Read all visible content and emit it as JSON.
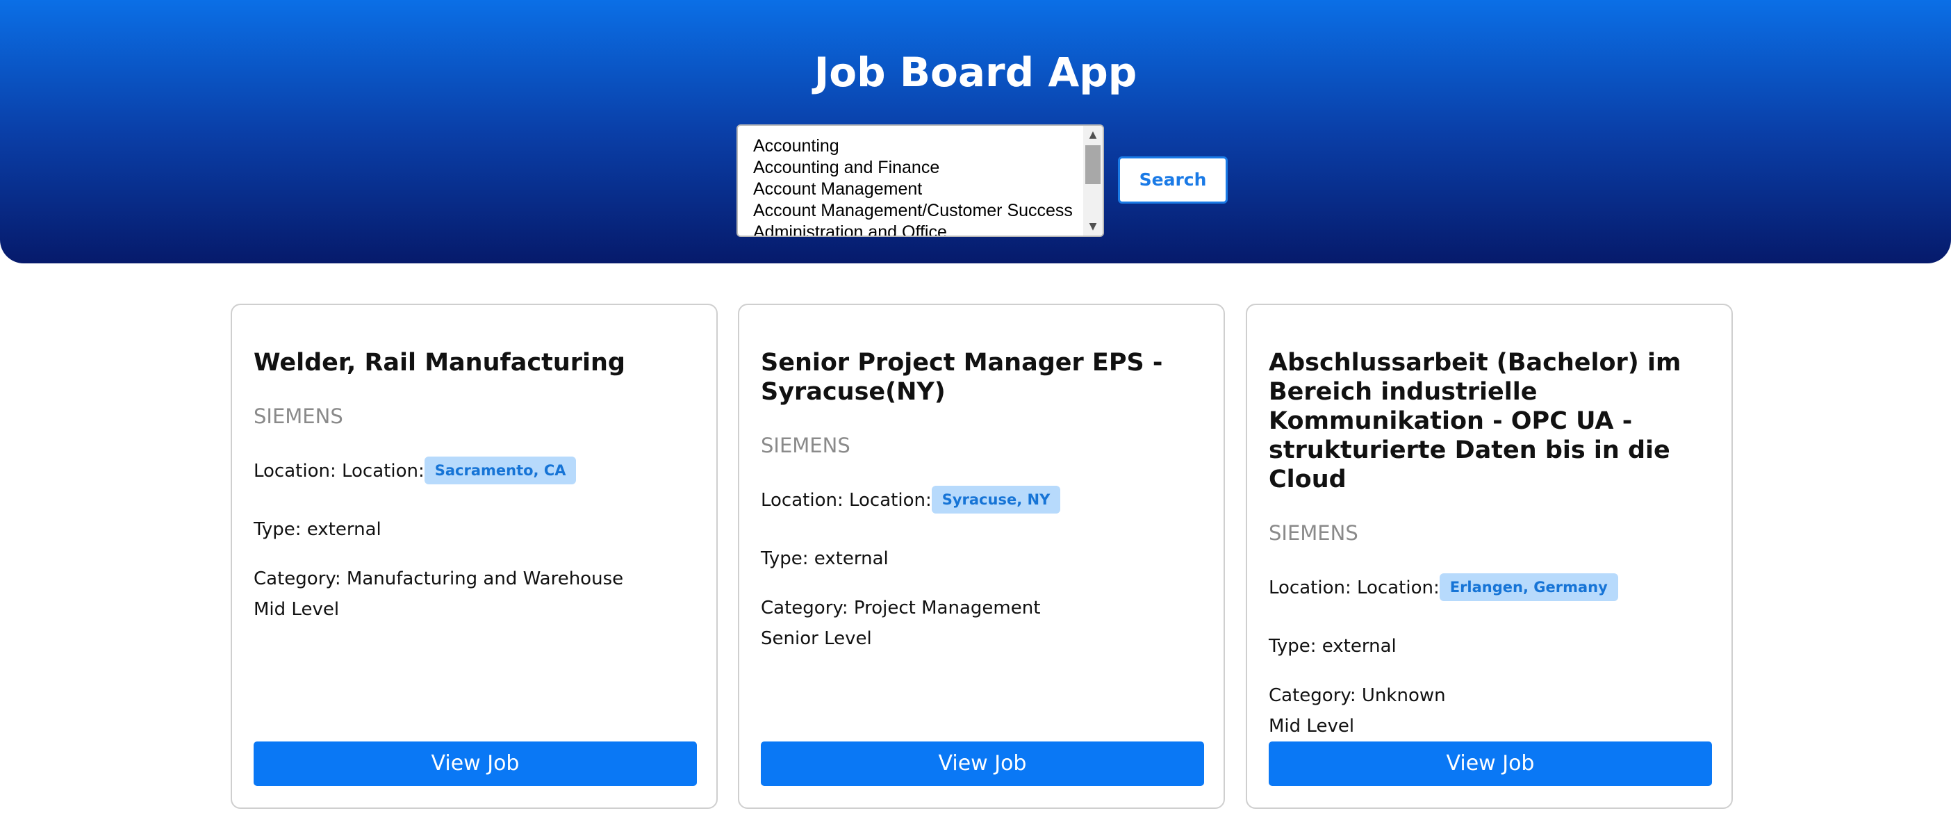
{
  "header": {
    "title": "Job Board App",
    "search_button_label": "Search"
  },
  "category_select": {
    "options": [
      "Accounting",
      "Accounting and Finance",
      "Account Management",
      "Account Management/Customer Success",
      "Administration and Office"
    ]
  },
  "colors": {
    "header_gradient_top": "#0b6fe6",
    "header_gradient_bottom": "#061a6b",
    "accent": "#0a78f5",
    "badge_bg": "#b7dafc",
    "badge_text": "#1674d6"
  },
  "jobs": [
    {
      "title": "Welder, Rail Manufacturing",
      "company": "SIEMENS",
      "location_label": "Location: Location:",
      "location": "Sacramento, CA",
      "type": "Type: external",
      "category": "Category: Manufacturing and Warehouse",
      "level": "Mid Level",
      "button_label": "View Job"
    },
    {
      "title": "Senior Project Manager EPS - Syracuse(NY)",
      "company": "SIEMENS",
      "location_label": "Location: Location:",
      "location": "Syracuse, NY",
      "type": "Type: external",
      "category": "Category: Project Management",
      "level": "Senior Level",
      "button_label": "View Job"
    },
    {
      "title": "Abschlussarbeit (Bachelor) im Bereich industrielle Kommunikation - OPC UA - strukturierte Daten bis in die Cloud",
      "company": "SIEMENS",
      "location_label": "Location: Location:",
      "location": "Erlangen, Germany",
      "type": "Type: external",
      "category": "Category: Unknown",
      "level": "Mid Level",
      "button_label": "View Job"
    }
  ]
}
